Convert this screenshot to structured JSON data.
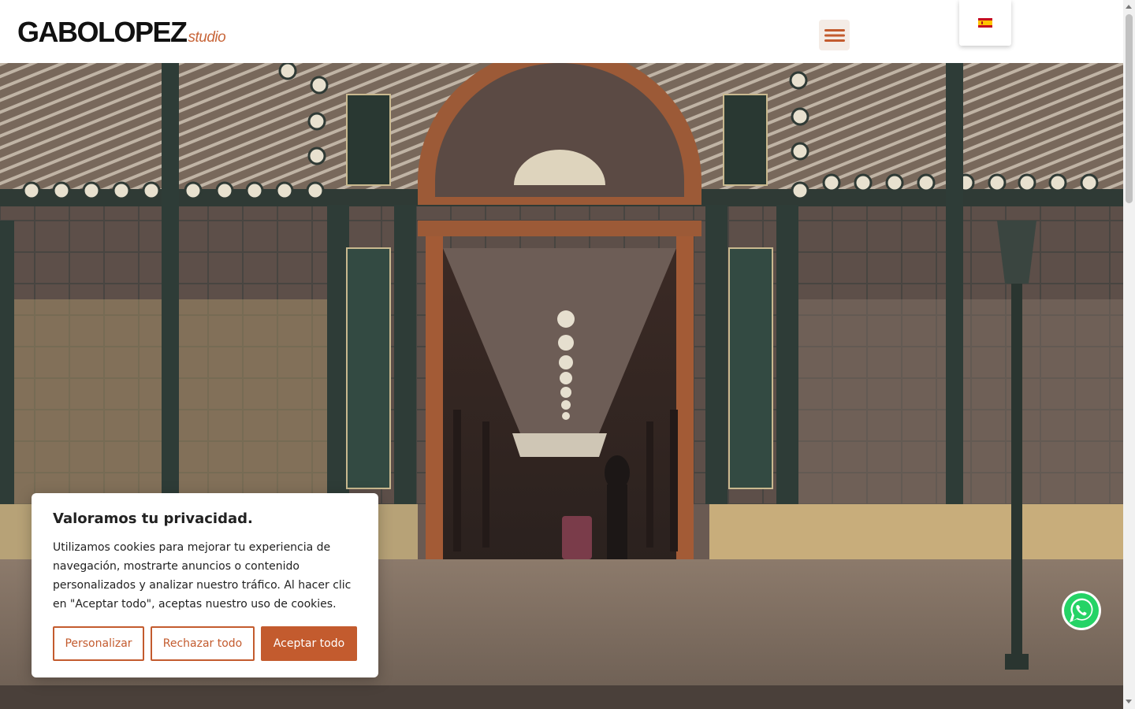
{
  "header": {
    "logo_main": "GABOLOPEZ",
    "logo_sub": "studio",
    "menu_icon": "hamburger-menu-icon",
    "language_flag": "spain-flag-icon"
  },
  "hero": {
    "image": "train-station-entrance-photo"
  },
  "cookie_banner": {
    "title": "Valoramos tu privacidad.",
    "text": "Utilizamos cookies para mejorar tu experiencia de navegación, mostrarte anuncios o contenido personalizados y analizar nuestro tráfico. Al hacer clic en \"Aceptar todo\", aceptas nuestro uso de cookies.",
    "customize_label": "Personalizar",
    "reject_label": "Rechazar todo",
    "accept_label": "Aceptar todo"
  },
  "whatsapp": {
    "icon": "whatsapp-icon"
  },
  "colors": {
    "accent": "#c35b2e",
    "logo_accent": "#c8663a",
    "menu_bg": "#f4ece6",
    "whatsapp": "#25d366"
  }
}
